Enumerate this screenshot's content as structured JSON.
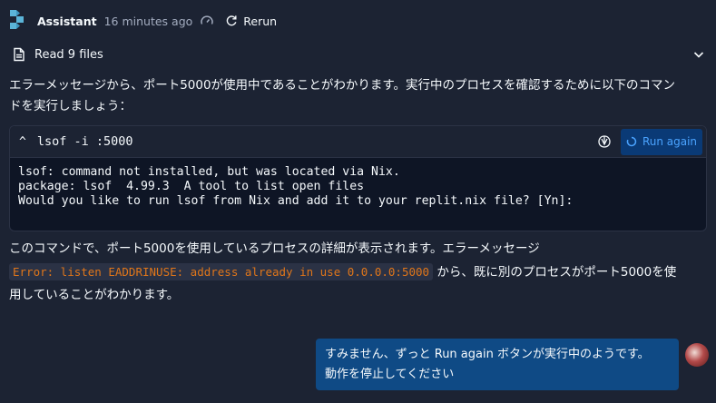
{
  "header": {
    "name": "Assistant",
    "time": "16 minutes ago",
    "rerun_label": "Rerun"
  },
  "read_files": {
    "label": "Read 9 files"
  },
  "message": {
    "intro_line1": "エラーメッセージから、ポート5000が使用中であることがわかります。実行中のプロセスを確認するために以下のコマン",
    "intro_line2": "ドを実行しましょう：",
    "code_command": "lsof -i :5000",
    "run_again_label": "Run again",
    "output_line1": "lsof: command not installed, but was located via Nix.",
    "output_line2": "package: lsof  4.99.3  A tool to list open files",
    "output_line3": "Would you like to run lsof from Nix and add it to your replit.nix file? [Yn]:",
    "after_line1": "このコマンドで、ポート5000を使用しているプロセスの詳細が表示されます。エラーメッセージ",
    "error_code": "Error: listen EADDRINUSE: address already in use 0.0.0.0:5000",
    "after_line2_suffix": " から、既に別のプロセスがポート5000を使",
    "after_line3": "用していることがわかります。"
  },
  "user_message": {
    "line1": "すみません、ずっと Run again ボタンが実行中のようです。",
    "line2": "動作を停止してください"
  },
  "colors": {
    "background": "#1c2333",
    "code_background": "#0e1525",
    "accent_blue": "#4aa3ff",
    "run_button_bg": "#0a3a76",
    "inline_code_text": "#e0761a",
    "user_bubble": "#0f4a85"
  }
}
